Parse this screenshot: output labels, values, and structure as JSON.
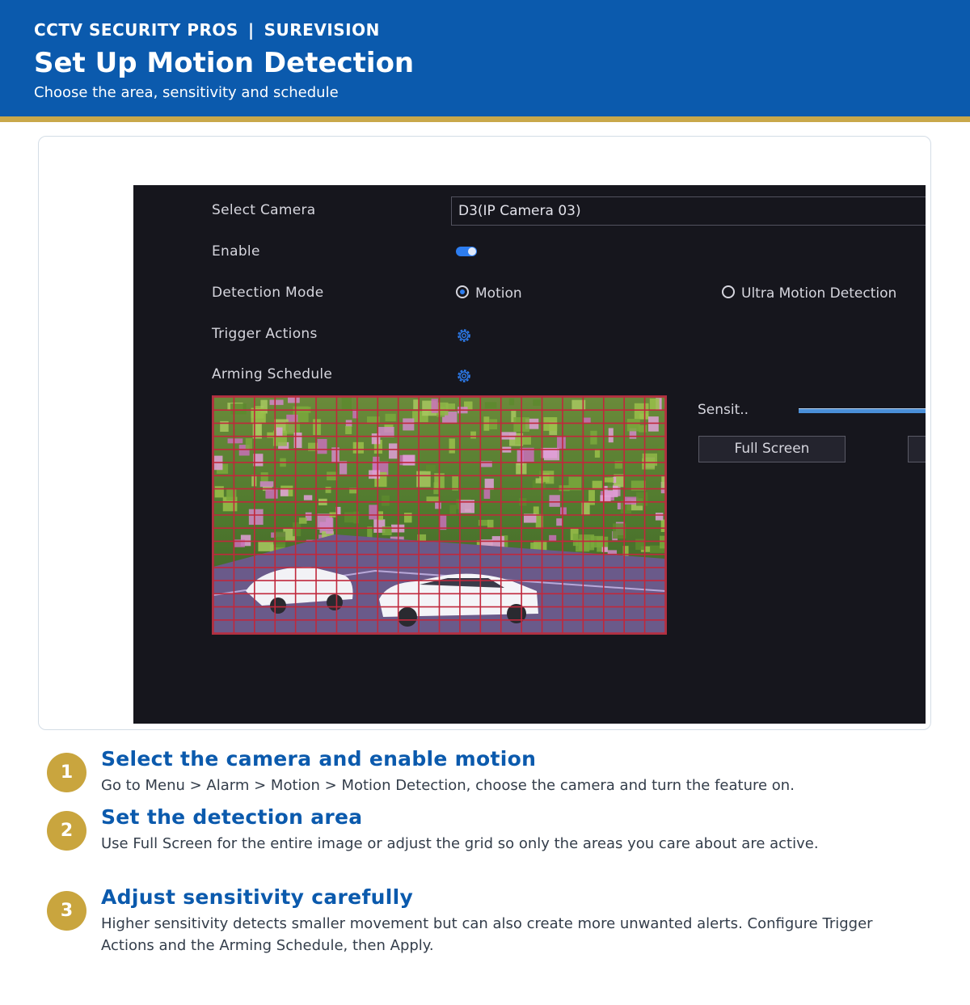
{
  "header": {
    "brand": "CCTV SECURITY PROS",
    "separator": "|",
    "partner": "SUREVISION",
    "title": "Set Up Motion Detection",
    "subtitle": "Choose the area, sensitivity and schedule"
  },
  "screen": {
    "select_camera_label": "Select Camera",
    "select_camera_value": "D3(IP Camera 03)",
    "enable_label": "Enable",
    "enable_on": true,
    "detection_mode_label": "Detection Mode",
    "mode_motion": "Motion",
    "mode_ultra": "Ultra Motion Detection",
    "trigger_actions_label": "Trigger Actions",
    "arming_schedule_label": "Arming Schedule",
    "sensitivity_label": "Sensit..",
    "full_screen_button": "Full Screen",
    "icons": {
      "trigger": "gear-icon",
      "schedule": "gear-icon"
    },
    "colors": {
      "accent": "#2d7df0",
      "grid": "#c0283c"
    }
  },
  "steps": [
    {
      "number": "1",
      "title": "Select the camera and enable motion",
      "text": "Go to Menu > Alarm > Motion > Motion Detection, choose the camera and turn the feature on."
    },
    {
      "number": "2",
      "title": "Set the detection area",
      "text": "Use Full Screen for the entire image or adjust the grid so only the areas you care about are active."
    },
    {
      "number": "3",
      "title": "Adjust sensitivity carefully",
      "text": "Higher sensitivity detects smaller movement but can also create more unwanted alerts. Configure Trigger Actions and the Arming Schedule, then Apply."
    }
  ]
}
